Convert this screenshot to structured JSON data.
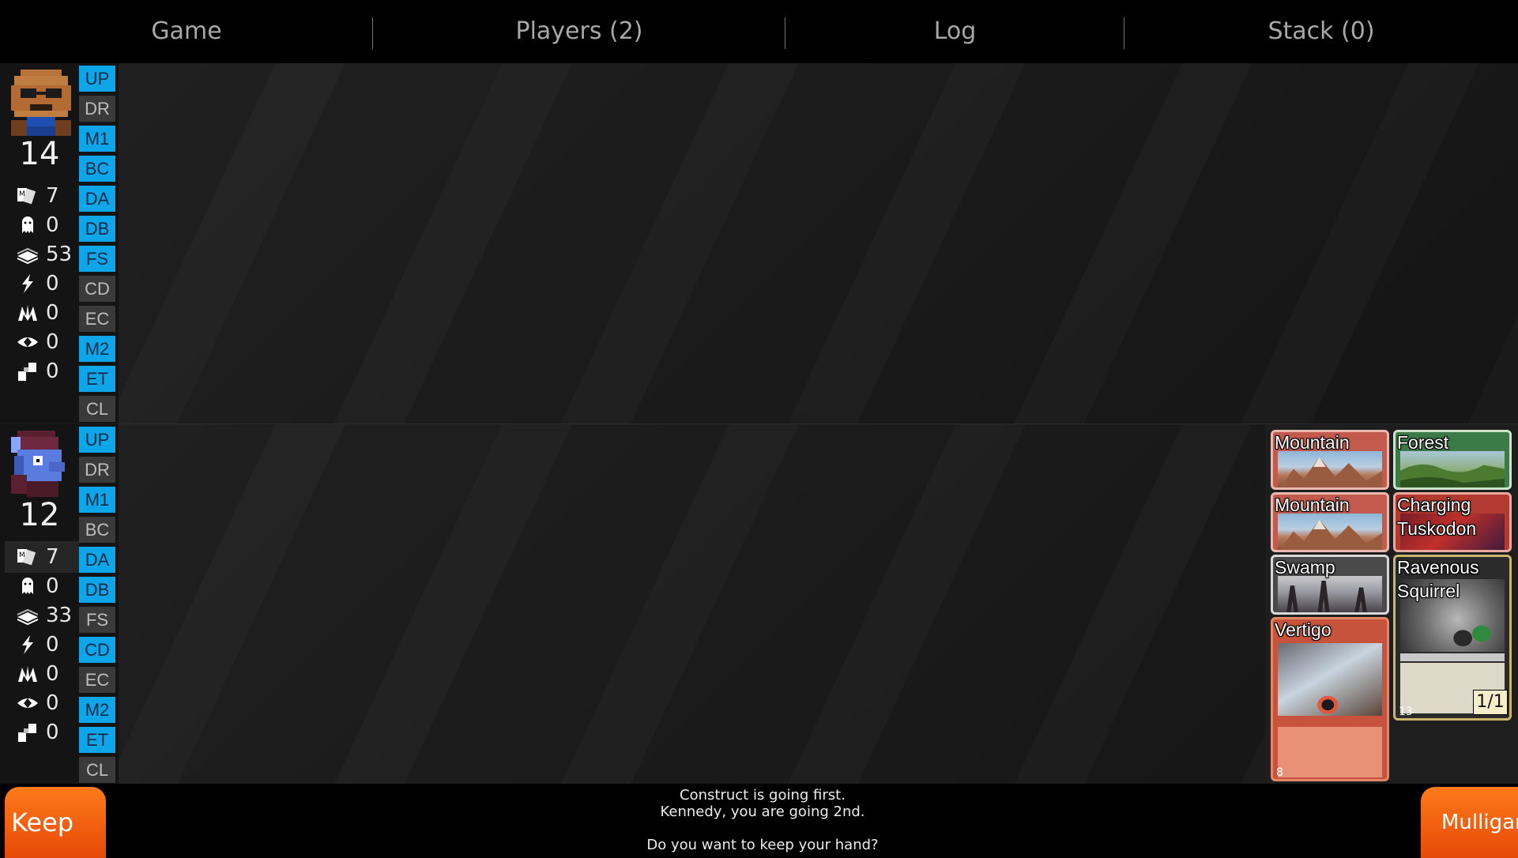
{
  "menu": {
    "tabs": [
      "Game",
      "Players (2)",
      "Log",
      "Stack (0)"
    ]
  },
  "phases": [
    "UP",
    "DR",
    "M1",
    "BC",
    "DA",
    "DB",
    "FS",
    "CD",
    "EC",
    "M2",
    "ET",
    "CL"
  ],
  "players": [
    {
      "life": "14",
      "hand": "7",
      "graveyard": "0",
      "library": "53",
      "energy": "0",
      "mana": "0",
      "exile": "0",
      "command": "0",
      "phase_state": [
        true,
        false,
        true,
        true,
        true,
        true,
        true,
        false,
        false,
        true,
        true,
        false
      ]
    },
    {
      "life": "12",
      "hand": "7",
      "graveyard": "0",
      "library": "33",
      "energy": "0",
      "mana": "0",
      "exile": "0",
      "command": "0",
      "phase_state": [
        true,
        false,
        true,
        false,
        true,
        true,
        false,
        true,
        false,
        true,
        true,
        false
      ]
    }
  ],
  "hand_cards": [
    {
      "name": "Mountain",
      "color": "red-land"
    },
    {
      "name": "Forest",
      "color": "green-land"
    },
    {
      "name": "Mountain",
      "color": "red-land"
    },
    {
      "name": "Charging Tuskodon",
      "color": "red-creature"
    },
    {
      "name": "Swamp",
      "color": "black-land"
    },
    {
      "name": "Ravenous Squirrel",
      "color": "gold-creature",
      "pt": "1/1",
      "number": "13"
    },
    {
      "name": "Vertigo",
      "color": "red-instant",
      "number": "8"
    }
  ],
  "prompt": {
    "line1": "Construct is going first.",
    "line2": "Kennedy, you are going 2nd.",
    "line3": "Do you want to keep your hand?"
  },
  "buttons": {
    "keep": "Keep",
    "mulligan": "Mulligan"
  },
  "colors": {
    "phase_active": "#0ea5e9",
    "button": "#ff6a10"
  }
}
